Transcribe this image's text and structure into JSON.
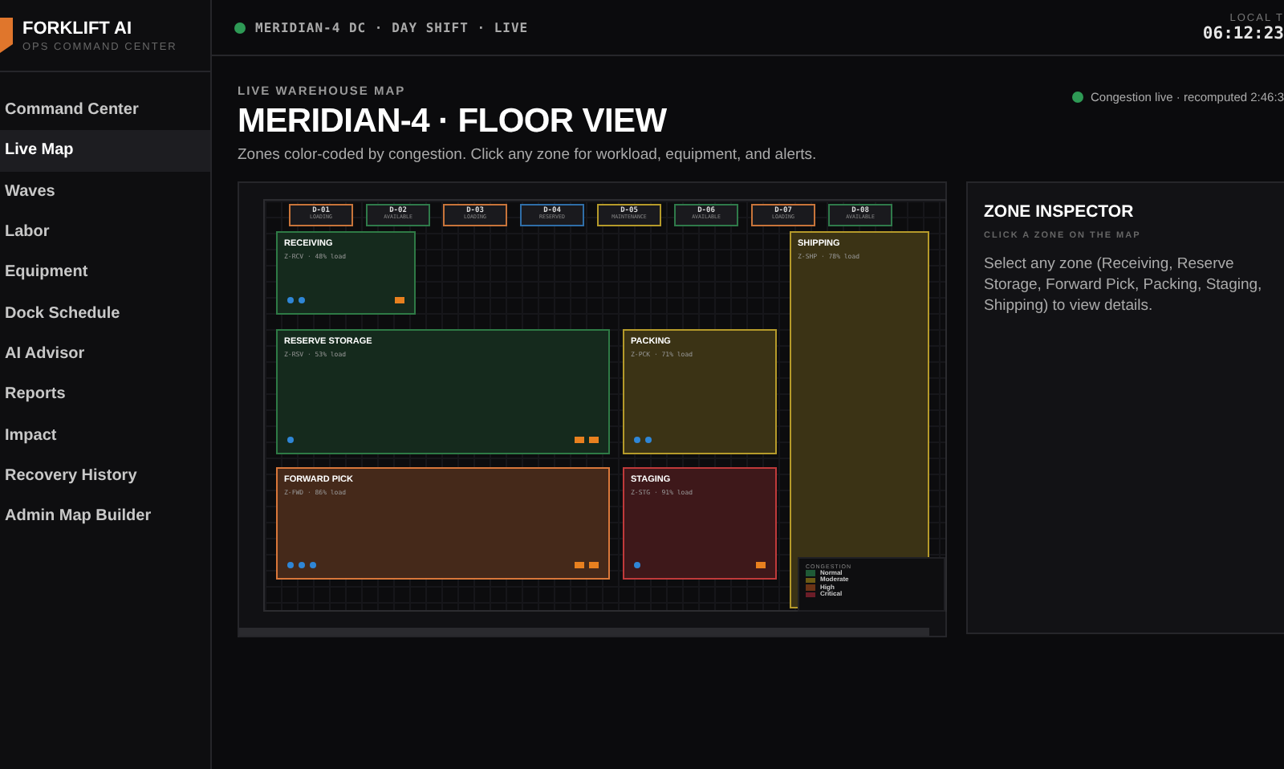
{
  "brand": {
    "name": "FORKLIFT AI",
    "tagline": "OPS COMMAND CENTER"
  },
  "sidebar": {
    "items": [
      {
        "label": "Command Center",
        "selected": false
      },
      {
        "label": "Live Map",
        "selected": true
      },
      {
        "label": "Waves",
        "selected": false
      },
      {
        "label": "Labor",
        "selected": false
      },
      {
        "label": "Equipment",
        "selected": false
      },
      {
        "label": "Dock Schedule",
        "selected": false
      },
      {
        "label": "AI Advisor",
        "selected": false
      },
      {
        "label": "Reports",
        "selected": false
      },
      {
        "label": "Impact",
        "selected": false
      },
      {
        "label": "Recovery History",
        "selected": false
      },
      {
        "label": "Admin Map Builder",
        "selected": false
      }
    ]
  },
  "topbar": {
    "site": "MERIDIAN-4 DC · DAY SHIFT · LIVE",
    "clock_label": "LOCAL T",
    "clock": "06:12:23"
  },
  "header": {
    "eyebrow": "LIVE WAREHOUSE MAP",
    "title": "MERIDIAN-4 · FLOOR VIEW",
    "subtitle": "Zones color-coded by congestion. Click any zone for workload, equipment, and alerts.",
    "status": "Congestion live · recomputed 2:46:3"
  },
  "map": {
    "docks": [
      {
        "id": "D-01",
        "status": "LOADING",
        "color": "#c8743a"
      },
      {
        "id": "D-02",
        "status": "AVAILABLE",
        "color": "#2f7a4a"
      },
      {
        "id": "D-03",
        "status": "LOADING",
        "color": "#c8743a"
      },
      {
        "id": "D-04",
        "status": "RESERVED",
        "color": "#2f6ea8"
      },
      {
        "id": "D-05",
        "status": "MAINTENANCE",
        "color": "#b59a2a"
      },
      {
        "id": "D-06",
        "status": "AVAILABLE",
        "color": "#2f7a4a"
      },
      {
        "id": "D-07",
        "status": "LOADING",
        "color": "#c8743a"
      },
      {
        "id": "D-08",
        "status": "AVAILABLE",
        "color": "#2f7a4a"
      }
    ],
    "zones": [
      {
        "name": "RECEIVING",
        "detail": "Z-RCV · 48% load",
        "color": "#2e7a45",
        "kind": "receiving",
        "markers": [
          {
            "kind": "vehicle"
          },
          {
            "kind": "vehicle"
          },
          {
            "kind": "alert"
          }
        ]
      },
      {
        "name": "SHIPPING",
        "detail": "Z-SHP · 78% load",
        "color": "#b59a2a",
        "kind": "shipping"
      },
      {
        "name": "RESERVE STORAGE",
        "detail": "Z-RSV · 53% load",
        "color": "#2e7a45",
        "kind": "storage",
        "markers": [
          {
            "kind": "vehicle"
          },
          {
            "kind": "alert"
          },
          {
            "kind": "alert"
          }
        ]
      },
      {
        "name": "PACKING",
        "detail": "Z-PCK · 71% load",
        "color": "#b59a2a",
        "kind": "packing",
        "markers": [
          {
            "kind": "vehicle"
          },
          {
            "kind": "vehicle"
          }
        ]
      },
      {
        "name": "FORWARD PICK",
        "detail": "Z-FWD · 86% load",
        "color": "#d9773a",
        "kind": "picking",
        "markers": [
          {
            "kind": "vehicle"
          },
          {
            "kind": "vehicle"
          },
          {
            "kind": "vehicle"
          },
          {
            "kind": "alert"
          },
          {
            "kind": "alert"
          }
        ]
      },
      {
        "name": "STAGING",
        "detail": "Z-STG · 91% load",
        "color": "#c03a3a",
        "kind": "staging",
        "markers": [
          {
            "kind": "vehicle"
          },
          {
            "kind": "alert"
          }
        ]
      }
    ],
    "legend": {
      "title": "CONGESTION",
      "items": [
        {
          "label": "Normal",
          "color": "#1f5a36"
        },
        {
          "label": "Moderate",
          "color": "#6b5a14"
        },
        {
          "label": "High",
          "color": "#6b3316"
        },
        {
          "label": "Critical",
          "color": "#6b1d28"
        }
      ]
    }
  },
  "inspector": {
    "title": "ZONE INSPECTOR",
    "hint": "CLICK A ZONE ON THE MAP",
    "body": "Select any zone (Receiving, Reserve Storage, Forward Pick, Packing, Staging, Shipping) to view details."
  }
}
